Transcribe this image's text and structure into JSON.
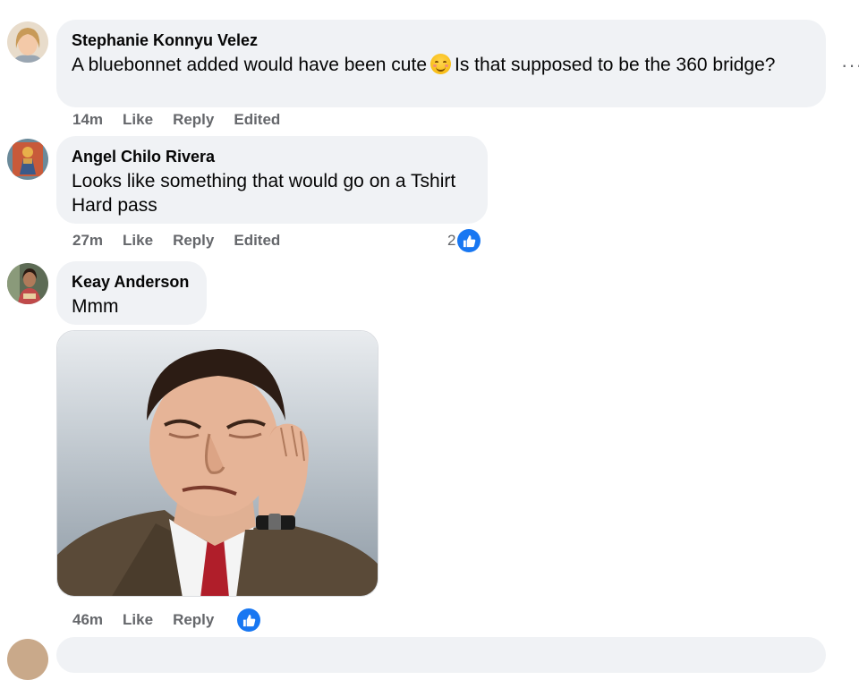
{
  "comments": [
    {
      "author": "Stephanie Konnyu Velez",
      "text_part1": "A bluebonnet added would have been cute",
      "emoji": "smiling-face-with-smiling-eyes",
      "text_part2": "Is that supposed to be the 360 bridge?",
      "time": "14m",
      "like": "Like",
      "reply": "Reply",
      "edited": "Edited"
    },
    {
      "author": "Angel Chilo Rivera",
      "text_line1": "Looks like something that would go on a Tshirt",
      "text_line2": "Hard pass",
      "time": "27m",
      "like": "Like",
      "reply": "Reply",
      "edited": "Edited",
      "reaction_count": "2"
    },
    {
      "author": "Keay Anderson",
      "text": "Mmm",
      "time": "46m",
      "like": "Like",
      "reply": "Reply",
      "attachment": "mr-bean-meme-image"
    }
  ],
  "more_options": "···",
  "colors": {
    "bubble": "#f0f2f5",
    "meta": "#65676b",
    "like_blue": "#1877f2"
  }
}
